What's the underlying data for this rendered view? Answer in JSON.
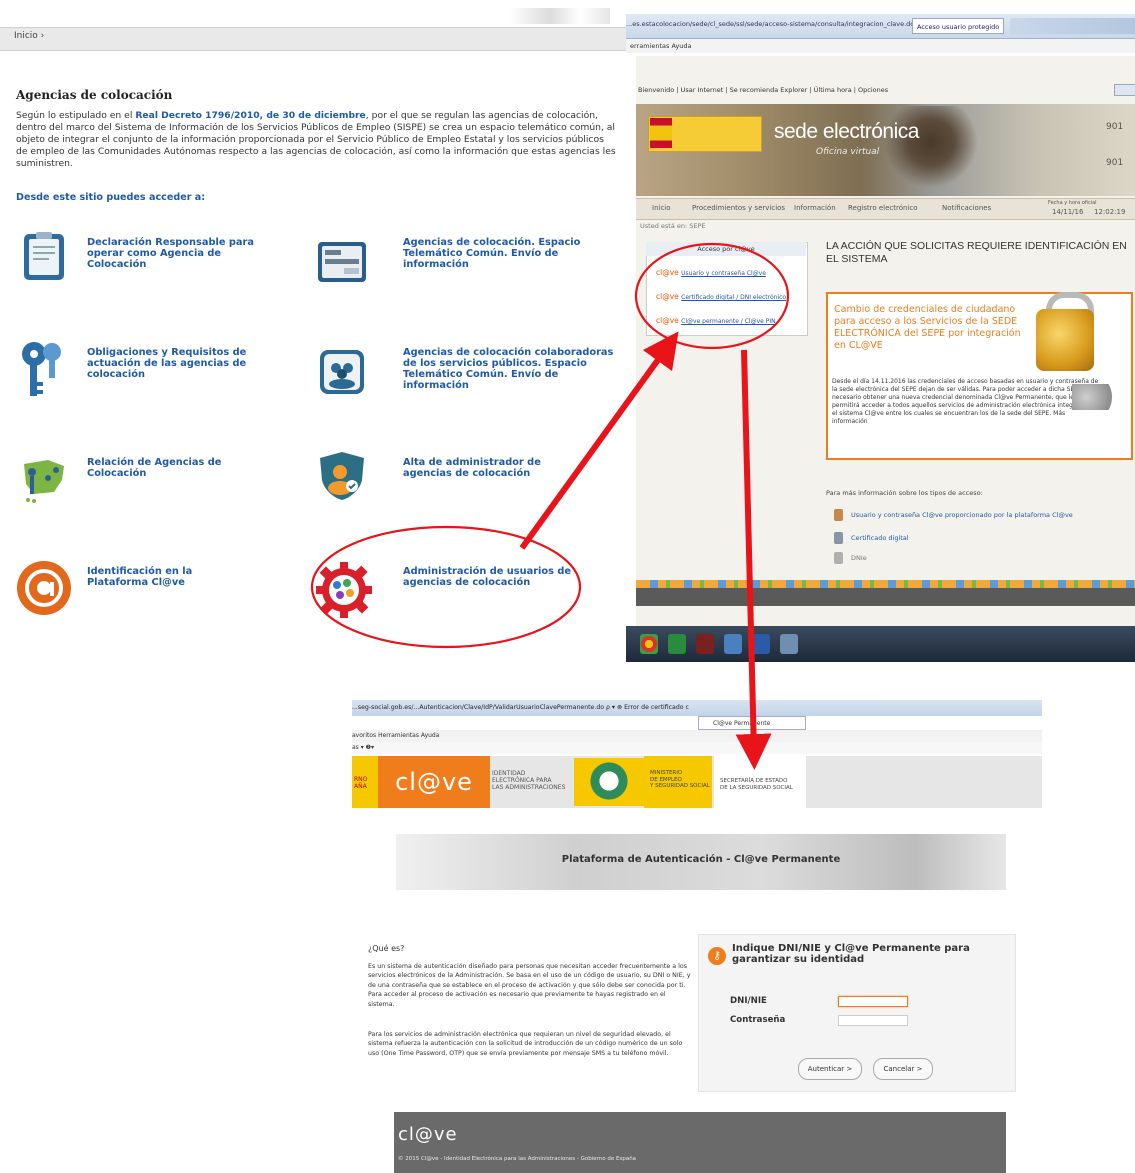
{
  "left_page": {
    "breadcrumb": "Inicio ›",
    "title": "Agencias de colocación",
    "intro_1": "Según lo estipulado en el ",
    "intro_link": "Real Decreto 1796/2010, de 30 de diciembre",
    "intro_2": ", por el que se regulan las agencias de colocación, dentro del marco del Sistema de Información de los Servicios Públicos de Empleo (SISPE) se crea un espacio telemático común, al objeto de integrar el conjunto de la información proporcionada por el Servicio Público de Empleo Estatal y los servicios públicos de empleo de las Comunidades Autónomas respecto a las agencias de colocación, así como la información que estas agencias les suministren.",
    "subtitle": "Desde este sitio puedes acceder a:",
    "tiles": [
      {
        "label": "Declaración Responsable para operar como Agencia de Colocación",
        "icon": "clipboard-icon"
      },
      {
        "label": "Agencias de colocación. Espacio Telemático Común. Envío de información",
        "icon": "form-icon"
      },
      {
        "label": "Obligaciones y Requisitos de actuación de las agencias de colocación",
        "icon": "keys-icon"
      },
      {
        "label": "Agencias de colocación colaboradoras de los servicios públicos. Espacio Telemático Común. Envío de información",
        "icon": "people-icon"
      },
      {
        "label": "Relación de Agencias de Colocación",
        "icon": "spain-map-icon"
      },
      {
        "label": "Alta de administrador de agencias de colocación",
        "icon": "shield-user-icon"
      },
      {
        "label": "Identificación en la Plataforma Cl@ve",
        "icon": "clave-icon"
      },
      {
        "label": "Administración de usuarios de agencias de colocación",
        "icon": "gear-users-icon"
      }
    ]
  },
  "sede": {
    "url": "...es.estacolocacion/sede/cl_sede/ssl/sede/acceso-sistema/consulta/integracion_clave.do  ρ ▾ 🔒 c",
    "tab": "Acceso usuario protegido",
    "menu": "erramientas   Ayuda",
    "header_links": "Bienvenido | Usar Internet | Se recomienda Explorer | Última hora | Opciones",
    "logo_text": "sede electrónica",
    "logo_sub": "Oficina virtual",
    "side_1": "901",
    "side_2": "901",
    "nav": [
      "Inicio",
      "Procedimientos y servicios",
      "Información",
      "Registro electrónico",
      "Notificaciones"
    ],
    "date_label": "Fecha y hora oficial",
    "date": "14/11/16",
    "time": "12:02:19",
    "crumb": "Usted está en: SEPE",
    "access_header": "Acceso por cl@ve",
    "access_options": [
      "Usuario y contraseña Cl@ve",
      "Certificado digital / DNI electrónico",
      "Cl@ve permanente / Cl@ve PIN"
    ],
    "heading": "LA ACCIÓN QUE SOLICITAS REQUIERE IDENTIFICACIÓN EN EL SISTEMA",
    "notice_title": "Cambio de credenciales de ciudadano para acceso a los Servicios de la SEDE ELECTRÓNICA del SEPE por integración en CL@VE",
    "notice_body": "Desde el día 14.11.2016 las credenciales de acceso basadas en usuario y contraseña de la sede electrónica del SEPE dejan de ser válidas. Para poder acceder a dicha SEDE será necesario obtener una nueva credencial denominada Cl@ve Permanente, que le permitirá acceder a todos aquellos servicios de administración electrónica integrados en el sistema Cl@ve entre los cuales se encuentran los de la sede del SEPE. Más información",
    "tipos": "Para más información sobre los tipos de acceso:",
    "tipos_options": [
      "Usuario y contraseña Cl@ve proporcionado por la plataforma Cl@ve",
      "Certificado digital",
      "DNIe"
    ]
  },
  "clave": {
    "url": "...seg-social.gob.es/...Autenticacion/Clave/IdP/ValidarUsuarioClavePermanente.do  ρ ▾ ⊗ Error de certificado  c",
    "tab": "Cl@ve Permanente",
    "menu": "avoritos   Herramientas   Ayuda",
    "tools": "as ▾  ❷▾",
    "logo": "cl@ve",
    "ident": [
      "IDENTIDAD",
      "ELECTRÓNICA PARA",
      "LAS ADMINISTRACIONES"
    ],
    "ministerio": [
      "MINISTERIO",
      "DE EMPLEO",
      "Y SEGURIDAD SOCIAL"
    ],
    "secretaria": [
      "SECRETARÍA DE ESTADO",
      "DE LA SEGURIDAD SOCIAL"
    ],
    "gob": "RNO\nAÑA",
    "banner": "Plataforma de Autenticación - Cl@ve Permanente",
    "que_es": "¿Qué es?",
    "para_1": "Es un sistema de autenticación diseñado para personas que necesitan acceder frecuentemente a los servicios electrónicos de la Administración. Se basa en el uso de un código de usuario, su DNI o NIE, y de una contraseña que se establece en el proceso de activación y que sólo debe ser conocida por ti. Para acceder al proceso de activación es necesario que previamente te hayas registrado en el sistema.",
    "para_2": "Para los servicios de administración electrónica que requieran un nivel de seguridad elevado, el sistema refuerza la autenticación con la solicitud de introducción de un código numérico de un solo uso (One Time Password, OTP) que se envía previamente por mensaje SMS a tu teléfono móvil.",
    "form_title": "Indique DNI/NIE y Cl@ve Permanente para garantizar su identidad",
    "dni_label": "DNI/NIE",
    "pwd_label": "Contraseña",
    "dni_value": "",
    "pwd_value": "",
    "btn_auth": "Autenticar >",
    "btn_cancel": "Cancelar >",
    "footer_logo": "cl@ve",
    "footer_text": "© 2015 Cl@ve - Identidad Electrónica para las Administraciones - Gobierno de España"
  },
  "colors": {
    "link_blue": "#1f5aa6",
    "clave_orange": "#f07d1c",
    "annotation_red": "#e8141a"
  }
}
